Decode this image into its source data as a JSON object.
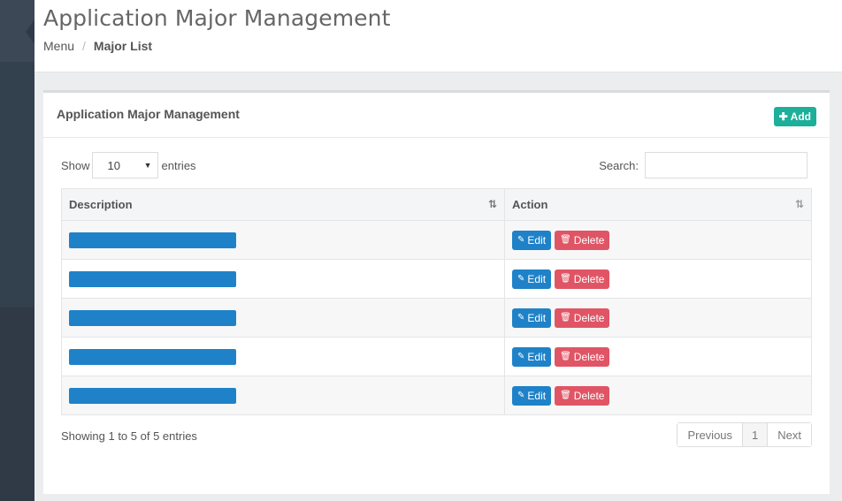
{
  "header": {
    "title": "Application Major Management",
    "breadcrumb": {
      "root": "Menu",
      "separator": "/",
      "current": "Major List"
    }
  },
  "panel": {
    "title": "Application Major Management",
    "add_label": "Add"
  },
  "table_controls": {
    "show_label": "Show",
    "entries_value": "10",
    "entries_label": "entries",
    "search_label": "Search:"
  },
  "table": {
    "columns": [
      "Description",
      "Action"
    ],
    "rows": [
      {
        "edit_label": "Edit",
        "delete_label": "Delete"
      },
      {
        "edit_label": "Edit",
        "delete_label": "Delete"
      },
      {
        "edit_label": "Edit",
        "delete_label": "Delete"
      },
      {
        "edit_label": "Edit",
        "delete_label": "Delete"
      },
      {
        "edit_label": "Edit",
        "delete_label": "Delete"
      }
    ]
  },
  "footer": {
    "info": "Showing 1 to 5 of 5 entries",
    "previous": "Previous",
    "page": "1",
    "next": "Next"
  },
  "colors": {
    "add_button": "#1caf9a",
    "edit_button": "#1f82c8",
    "delete_button": "#e05565",
    "sidebar": "#2f3a46"
  },
  "icons": {
    "add": "plus-icon",
    "edit": "pencil-icon",
    "delete": "trash-icon",
    "sort_asc": "sort-amount-asc-icon",
    "sort": "sort-icon"
  }
}
